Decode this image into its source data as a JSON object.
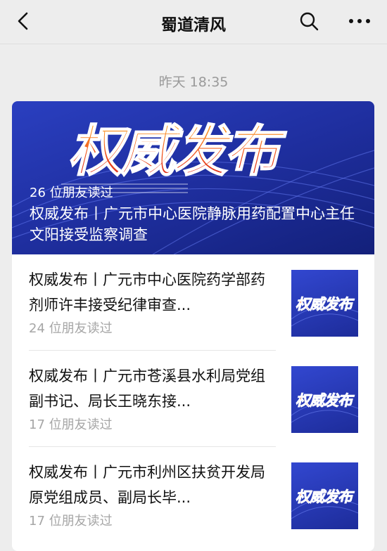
{
  "nav": {
    "title": "蜀道清风",
    "back_icon": "chevron-left-icon",
    "search_icon": "search-icon",
    "more_icon": "more-dots-icon"
  },
  "timestamp": "昨天 18:35",
  "hero": {
    "banner_text": "权威发布",
    "reads": "26 位朋友读过",
    "title": "权威发布丨广元市中心医院静脉用药配置中心主任文阳接受监察调查"
  },
  "articles": [
    {
      "title": "权威发布丨广元市中心医院药学部药剂师许丰接受纪律审查...",
      "reads": "24 位朋友读过",
      "thumb_text": "权威发布"
    },
    {
      "title": "权威发布丨广元市苍溪县水利局党组副书记、局长王晓东接...",
      "reads": "17 位朋友读过",
      "thumb_text": "权威发布"
    },
    {
      "title": "权威发布丨广元市利州区扶贫开发局原党组成员、副局长毕...",
      "reads": "17 位朋友读过",
      "thumb_text": "权威发布"
    }
  ],
  "colors": {
    "banner_blue": "#1f2fa0",
    "banner_red": "#e8321e",
    "banner_orange": "#f39a1e"
  }
}
